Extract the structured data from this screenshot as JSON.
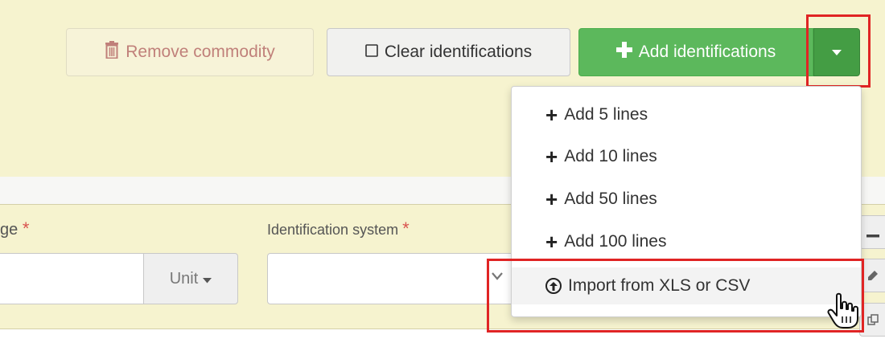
{
  "toolbar": {
    "remove_label": "Remove commodity",
    "clear_label": "Clear identifications",
    "add_label": "Add identifications"
  },
  "dropdown": {
    "items": [
      {
        "label": "Add 5 lines",
        "icon": "plus-icon"
      },
      {
        "label": "Add 10 lines",
        "icon": "plus-icon"
      },
      {
        "label": "Add 50 lines",
        "icon": "plus-icon"
      },
      {
        "label": "Add 100 lines",
        "icon": "plus-icon"
      },
      {
        "label": "Import from XLS or CSV",
        "icon": "upload-icon"
      }
    ]
  },
  "form": {
    "range_label_partial": "ge",
    "required_mark": "*",
    "unit_label": "Unit",
    "identification_system_label": "Identification system",
    "identification_system_value": ""
  },
  "colors": {
    "panel_bg": "#f6f3cf",
    "success": "#5cb85c",
    "success_dark": "#449d44",
    "danger_text": "#c0807a",
    "highlight": "#e02424"
  }
}
